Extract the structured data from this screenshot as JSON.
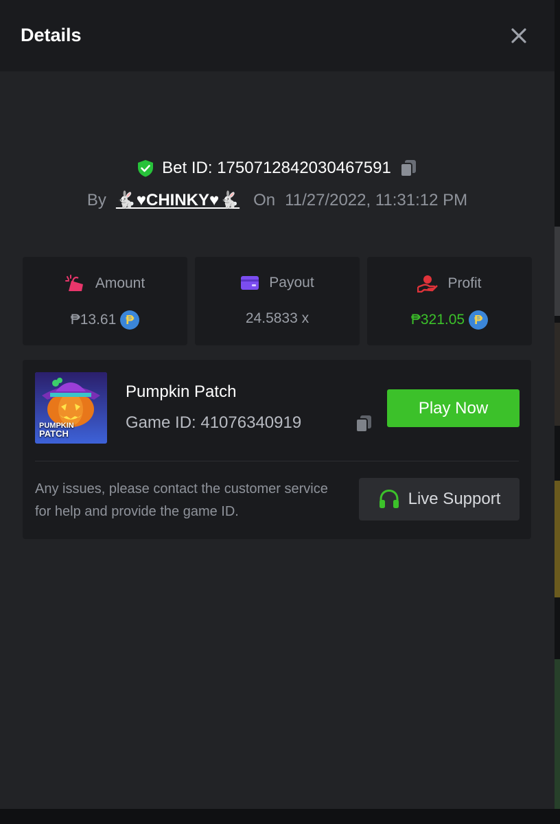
{
  "header": {
    "title": "Details"
  },
  "bet": {
    "id_text": "Bet ID: 1750712842030467591",
    "by_label": "By",
    "username": "🐇♥CHINKY♥🐇",
    "on_label": "On",
    "datetime": "11/27/2022, 11:31:12 PM"
  },
  "stats": {
    "amount": {
      "label": "Amount",
      "value": "₱13.61"
    },
    "payout": {
      "label": "Payout",
      "value": "24.5833 x"
    },
    "profit": {
      "label": "Profit",
      "value": "₱321.05"
    },
    "coin_symbol": "₱"
  },
  "game": {
    "name": "Pumpkin Patch",
    "id_text": "Game ID: 41076340919",
    "thumb_title_line1": "PUMPKIN",
    "thumb_title_line2": "PATCH",
    "play_label": "Play Now"
  },
  "support": {
    "help_text": "Any issues, please contact the customer service for help and provide the game ID.",
    "button_label": "Live Support"
  },
  "colors": {
    "accent_green": "#3cc12a",
    "amount_icon": "#e8366b",
    "payout_icon": "#7b4df0",
    "profit_icon": "#e0333a",
    "coin": "#3b86d8"
  }
}
